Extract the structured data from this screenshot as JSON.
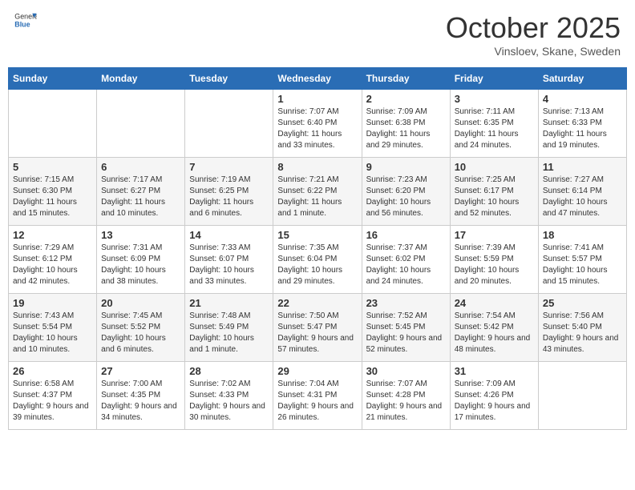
{
  "header": {
    "logo_general": "General",
    "logo_blue": "Blue",
    "month": "October 2025",
    "location": "Vinsloev, Skane, Sweden"
  },
  "days_of_week": [
    "Sunday",
    "Monday",
    "Tuesday",
    "Wednesday",
    "Thursday",
    "Friday",
    "Saturday"
  ],
  "weeks": [
    [
      {
        "day": "",
        "info": ""
      },
      {
        "day": "",
        "info": ""
      },
      {
        "day": "",
        "info": ""
      },
      {
        "day": "1",
        "info": "Sunrise: 7:07 AM\nSunset: 6:40 PM\nDaylight: 11 hours and 33 minutes."
      },
      {
        "day": "2",
        "info": "Sunrise: 7:09 AM\nSunset: 6:38 PM\nDaylight: 11 hours and 29 minutes."
      },
      {
        "day": "3",
        "info": "Sunrise: 7:11 AM\nSunset: 6:35 PM\nDaylight: 11 hours and 24 minutes."
      },
      {
        "day": "4",
        "info": "Sunrise: 7:13 AM\nSunset: 6:33 PM\nDaylight: 11 hours and 19 minutes."
      }
    ],
    [
      {
        "day": "5",
        "info": "Sunrise: 7:15 AM\nSunset: 6:30 PM\nDaylight: 11 hours and 15 minutes."
      },
      {
        "day": "6",
        "info": "Sunrise: 7:17 AM\nSunset: 6:27 PM\nDaylight: 11 hours and 10 minutes."
      },
      {
        "day": "7",
        "info": "Sunrise: 7:19 AM\nSunset: 6:25 PM\nDaylight: 11 hours and 6 minutes."
      },
      {
        "day": "8",
        "info": "Sunrise: 7:21 AM\nSunset: 6:22 PM\nDaylight: 11 hours and 1 minute."
      },
      {
        "day": "9",
        "info": "Sunrise: 7:23 AM\nSunset: 6:20 PM\nDaylight: 10 hours and 56 minutes."
      },
      {
        "day": "10",
        "info": "Sunrise: 7:25 AM\nSunset: 6:17 PM\nDaylight: 10 hours and 52 minutes."
      },
      {
        "day": "11",
        "info": "Sunrise: 7:27 AM\nSunset: 6:14 PM\nDaylight: 10 hours and 47 minutes."
      }
    ],
    [
      {
        "day": "12",
        "info": "Sunrise: 7:29 AM\nSunset: 6:12 PM\nDaylight: 10 hours and 42 minutes."
      },
      {
        "day": "13",
        "info": "Sunrise: 7:31 AM\nSunset: 6:09 PM\nDaylight: 10 hours and 38 minutes."
      },
      {
        "day": "14",
        "info": "Sunrise: 7:33 AM\nSunset: 6:07 PM\nDaylight: 10 hours and 33 minutes."
      },
      {
        "day": "15",
        "info": "Sunrise: 7:35 AM\nSunset: 6:04 PM\nDaylight: 10 hours and 29 minutes."
      },
      {
        "day": "16",
        "info": "Sunrise: 7:37 AM\nSunset: 6:02 PM\nDaylight: 10 hours and 24 minutes."
      },
      {
        "day": "17",
        "info": "Sunrise: 7:39 AM\nSunset: 5:59 PM\nDaylight: 10 hours and 20 minutes."
      },
      {
        "day": "18",
        "info": "Sunrise: 7:41 AM\nSunset: 5:57 PM\nDaylight: 10 hours and 15 minutes."
      }
    ],
    [
      {
        "day": "19",
        "info": "Sunrise: 7:43 AM\nSunset: 5:54 PM\nDaylight: 10 hours and 10 minutes."
      },
      {
        "day": "20",
        "info": "Sunrise: 7:45 AM\nSunset: 5:52 PM\nDaylight: 10 hours and 6 minutes."
      },
      {
        "day": "21",
        "info": "Sunrise: 7:48 AM\nSunset: 5:49 PM\nDaylight: 10 hours and 1 minute."
      },
      {
        "day": "22",
        "info": "Sunrise: 7:50 AM\nSunset: 5:47 PM\nDaylight: 9 hours and 57 minutes."
      },
      {
        "day": "23",
        "info": "Sunrise: 7:52 AM\nSunset: 5:45 PM\nDaylight: 9 hours and 52 minutes."
      },
      {
        "day": "24",
        "info": "Sunrise: 7:54 AM\nSunset: 5:42 PM\nDaylight: 9 hours and 48 minutes."
      },
      {
        "day": "25",
        "info": "Sunrise: 7:56 AM\nSunset: 5:40 PM\nDaylight: 9 hours and 43 minutes."
      }
    ],
    [
      {
        "day": "26",
        "info": "Sunrise: 6:58 AM\nSunset: 4:37 PM\nDaylight: 9 hours and 39 minutes."
      },
      {
        "day": "27",
        "info": "Sunrise: 7:00 AM\nSunset: 4:35 PM\nDaylight: 9 hours and 34 minutes."
      },
      {
        "day": "28",
        "info": "Sunrise: 7:02 AM\nSunset: 4:33 PM\nDaylight: 9 hours and 30 minutes."
      },
      {
        "day": "29",
        "info": "Sunrise: 7:04 AM\nSunset: 4:31 PM\nDaylight: 9 hours and 26 minutes."
      },
      {
        "day": "30",
        "info": "Sunrise: 7:07 AM\nSunset: 4:28 PM\nDaylight: 9 hours and 21 minutes."
      },
      {
        "day": "31",
        "info": "Sunrise: 7:09 AM\nSunset: 4:26 PM\nDaylight: 9 hours and 17 minutes."
      },
      {
        "day": "",
        "info": ""
      }
    ]
  ]
}
